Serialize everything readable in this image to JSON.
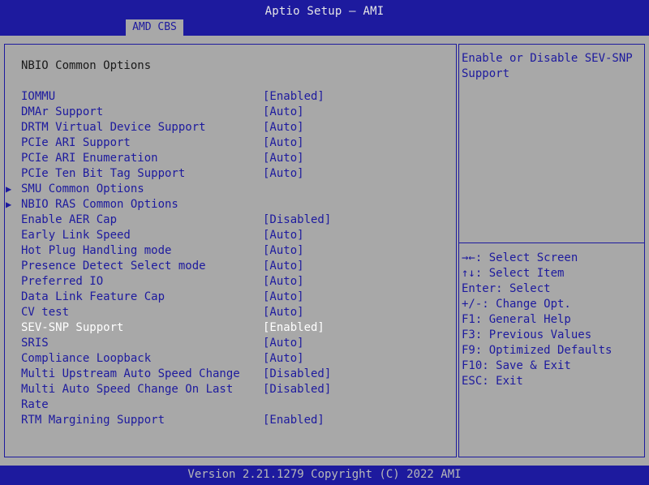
{
  "header": {
    "title": "Aptio Setup – AMI",
    "tab_label": "AMD CBS"
  },
  "section_title": "NBIO Common Options",
  "options": [
    {
      "label": "IOMMU",
      "value": "[Enabled]"
    },
    {
      "label": "DMAr Support",
      "value": "[Auto]"
    },
    {
      "label": "DRTM Virtual Device Support",
      "value": "[Auto]"
    },
    {
      "label": "PCIe ARI Support",
      "value": "[Auto]"
    },
    {
      "label": "PCIe ARI Enumeration",
      "value": "[Auto]"
    },
    {
      "label": "PCIe Ten Bit Tag Support",
      "value": "[Auto]"
    },
    {
      "label": "SMU Common Options",
      "value": "",
      "submenu": true
    },
    {
      "label": "NBIO RAS Common Options",
      "value": "",
      "submenu": true
    },
    {
      "label": "Enable AER Cap",
      "value": "[Disabled]"
    },
    {
      "label": "Early Link Speed",
      "value": "[Auto]"
    },
    {
      "label": "Hot Plug Handling mode",
      "value": "[Auto]"
    },
    {
      "label": "Presence Detect Select mode",
      "value": "[Auto]"
    },
    {
      "label": "Preferred IO",
      "value": "[Auto]"
    },
    {
      "label": "Data Link Feature Cap",
      "value": "[Auto]"
    },
    {
      "label": "CV test",
      "value": "[Auto]"
    },
    {
      "label": "SEV-SNP Support",
      "value": "[Enabled]",
      "selected": true
    },
    {
      "label": "SRIS",
      "value": "[Auto]"
    },
    {
      "label": "Compliance Loopback",
      "value": "[Auto]"
    },
    {
      "label": "Multi Upstream Auto Speed Change",
      "value": "[Disabled]"
    },
    {
      "label": "Multi Auto Speed Change On Last",
      "value": "[Disabled]"
    },
    {
      "label": "Rate",
      "value": ""
    },
    {
      "label": "RTM Margining Support",
      "value": "[Enabled]"
    }
  ],
  "help": {
    "line1": "Enable or Disable SEV-SNP",
    "line2": "Support"
  },
  "keys": [
    "→←: Select Screen",
    "↑↓: Select Item",
    "Enter: Select",
    "+/-: Change Opt.",
    "F1: General Help",
    "F3: Previous Values",
    "F9: Optimized Defaults",
    "F10: Save & Exit",
    "ESC: Exit"
  ],
  "footer": {
    "text": "Version 2.21.1279 Copyright (C) 2022 AMI"
  },
  "colors": {
    "background": "#1d1a9e",
    "panel": "#a8a8a8",
    "text": "#1d1a9e",
    "selected_text": "#ffffff"
  }
}
